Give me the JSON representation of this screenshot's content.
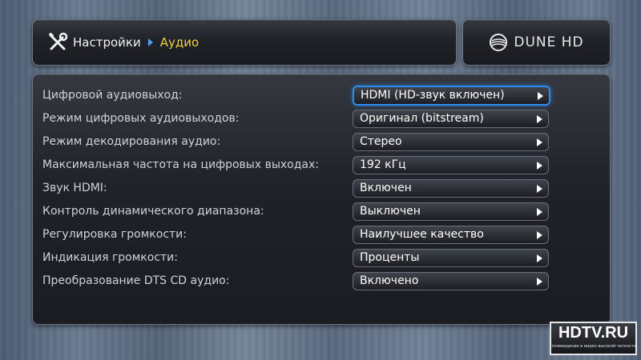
{
  "header": {
    "icon": "tools-icon",
    "breadcrumb_root": "Настройки",
    "breadcrumb_current": "Аудио"
  },
  "logo": {
    "icon": "dune-logo-icon",
    "text": "DUNE HD"
  },
  "settings": [
    {
      "label": "Цифровой аудиовыход:",
      "value": "HDMI (HD-звук включен)",
      "focused": true
    },
    {
      "label": "Режим цифровых аудиовыходов:",
      "value": "Оригинал (bitstream)"
    },
    {
      "label": "Режим декодирования аудио:",
      "value": "Стерео"
    },
    {
      "label": "Максимальная частота на цифровых выходах:",
      "value": "192 кГц"
    },
    {
      "label": "Звук HDMI:",
      "value": "Включен"
    },
    {
      "label": "Контроль динамического диапазона:",
      "value": "Выключен"
    },
    {
      "label": "Регулировка громкости:",
      "value": "Наилучшее качество"
    },
    {
      "label": "Индикация громкости:",
      "value": "Проценты"
    },
    {
      "label": "Преобразование DTS CD аудио:",
      "value": "Включено"
    }
  ],
  "watermark": {
    "title": "HDTV.RU",
    "subtitle": "телевидение и видео высокой четкости"
  },
  "colors": {
    "accent_focus": "#2e8cf0",
    "breadcrumb_current": "#f4d23c",
    "breadcrumb_separator": "#4aa3f0"
  }
}
